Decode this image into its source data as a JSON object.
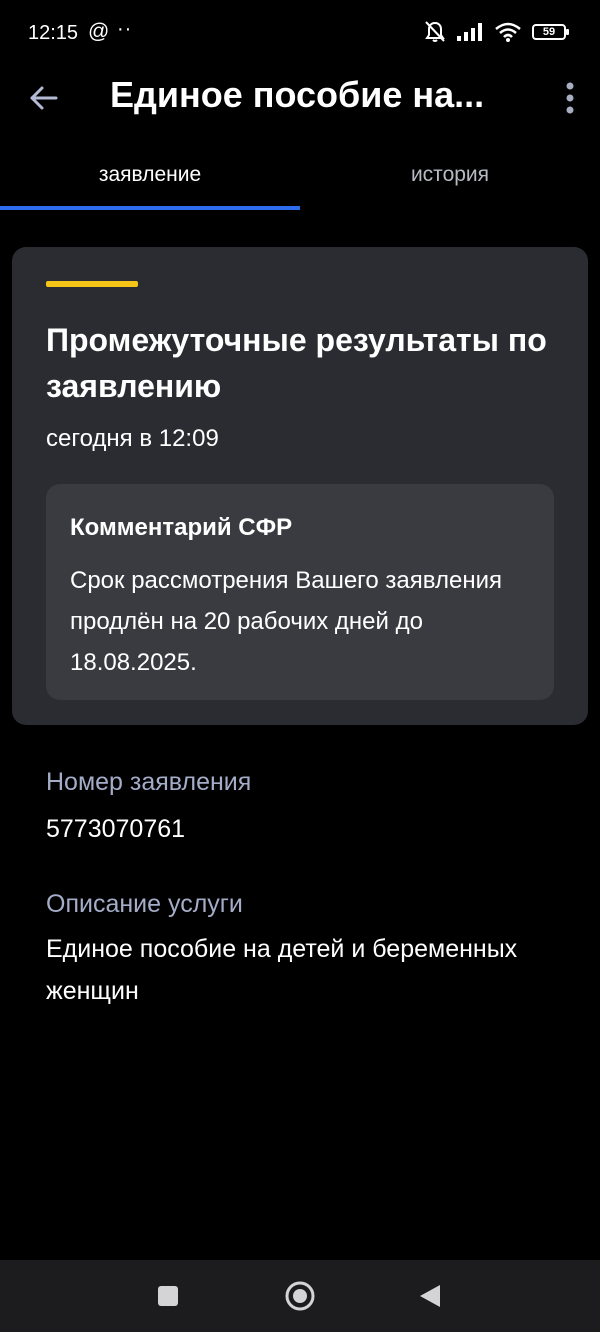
{
  "status_bar": {
    "time": "12:15",
    "at_symbol": "@",
    "dots": "··",
    "battery": "59"
  },
  "header": {
    "title": "Единое пособие на...",
    "back_icon": "arrow-left-icon",
    "more_icon": "more-vertical-icon"
  },
  "tabs": [
    {
      "label": "заявление",
      "active": true
    },
    {
      "label": "история",
      "active": false
    }
  ],
  "card": {
    "title": "Промежуточные результаты по заявлению",
    "time": "сегодня в 12:09",
    "accent_color": "#f5c518",
    "comment": {
      "title": "Комментарий СФР",
      "text": "Срок рассмотрения Вашего заявления продлён на 20 рабочих дней до 18.08.2025."
    }
  },
  "details": {
    "number_label": "Номер заявления",
    "number_value": "5773070761",
    "description_label": "Описание услуги",
    "description_value": "Единое пособие на детей и беременных женщин"
  },
  "colors": {
    "tab_indicator": "#2f6df0",
    "card_background": "#2b2c31",
    "label_color": "#a4acc8"
  }
}
